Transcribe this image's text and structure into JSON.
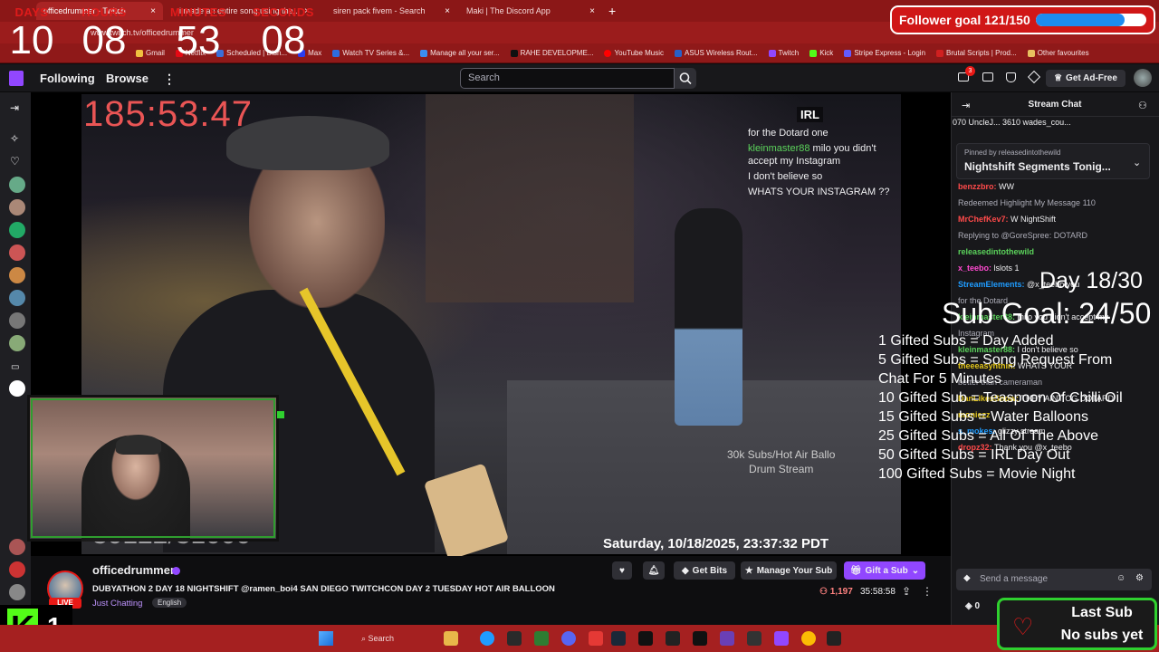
{
  "browser": {
    "tabs": [
      {
        "label": "officedrummer - Twitch",
        "active": true
      },
      {
        "label": "i made an entire song using the...",
        "active": false
      },
      {
        "label": "siren pack fivem - Search",
        "active": false
      },
      {
        "label": "Maki | The Discord App",
        "active": false
      }
    ],
    "url": "www.twitch.tv/officedrummer",
    "bookmarks": [
      "Gmail",
      "Netflix",
      "Scheduled | Disn...",
      "Max",
      "Watch TV Series &...",
      "Manage all your ser...",
      "RAHE DEVELOPME...",
      "YouTube Music",
      "ASUS Wireless Rout...",
      "Twitch",
      "Kick",
      "Stripe Express - Login",
      "Brutal Scripts | Prod...",
      "Other favourites"
    ]
  },
  "countdown": {
    "days_label": "DAYS",
    "days": "10",
    "hours_label": "HOURS",
    "hours": "08",
    "minutes_label": "MINUTES",
    "minutes": "53",
    "seconds_label": "SECONDS",
    "seconds": "08"
  },
  "follower_goal": {
    "label": "Follower goal 121/150",
    "current": 121,
    "target": 150,
    "color": "#1e8cf0"
  },
  "twitch_nav": {
    "following": "Following",
    "browse": "Browse",
    "search_placeholder": "Search",
    "notif_count": "3",
    "ad_free": "Get Ad-Free"
  },
  "video": {
    "timer": "185:53:47",
    "irl_logo": "IRL",
    "chat_overlay": [
      {
        "text": "for the Dotard one"
      },
      {
        "user": "kleinmaster88",
        "text": "milo you didn't accept my Instagram"
      },
      {
        "text": "I don't believe so"
      },
      {
        "text": "WHATS YOUR INSTAGRAM ??"
      }
    ],
    "datestamp": "Saturday, 10/18/2025, 23:37:32 PDT",
    "note_line1": "30k Subs/Hot Air Ballo",
    "note_line2": "Drum Stream",
    "sub_counter": "30122/31000"
  },
  "stream_info": {
    "channel": "officedrummer",
    "title": "DUBYATHON 2 DAY 18 NIGHTSHIFT @ramen_boi4 SAN DIEGO TWITCHCON DAY 2 TUESDAY HOT AIR BALLOON",
    "category": "Just Chatting",
    "language": "English",
    "live": "LIVE",
    "get_bits": "Get Bits",
    "manage_sub": "Manage Your Sub",
    "gift_sub": "Gift a Sub",
    "viewers": "1,197",
    "uptime": "35:58:58"
  },
  "chat": {
    "header": "Stream Chat",
    "leaderboard": "070  UncleJ...  3610  wades_cou...",
    "pinned_label": "Pinned by releasedintothewild",
    "pinned_text": "Nightshift Segments Tonig...",
    "messages": [
      {
        "user": "benzzbro",
        "text": "WW",
        "color": "#ff4a4a"
      },
      {
        "user": "",
        "text": "Redeemed Highlight My Message  110",
        "color": "#adadb8"
      },
      {
        "user": "MrChefKev7",
        "text": "W NightShift",
        "color": "#ff4a4a"
      },
      {
        "user": "",
        "text": "Replying to @GoreSpree: DOTARD",
        "color": "#adadb8"
      },
      {
        "user": "releasedintothewild",
        "text": "",
        "color": "#5bd35b"
      },
      {
        "user": "x_teebo",
        "text": "lslots 1",
        "color": "#ff4ad0"
      },
      {
        "user": "StreamElements",
        "text": "@x_teebo you",
        "color": "#1f9cff"
      },
      {
        "user": "",
        "text": "for the Dotard",
        "color": "#adadb8"
      },
      {
        "user": "kleinmaster88",
        "text": "milo you didn't accept my",
        "color": "#5bd35b"
      },
      {
        "user": "",
        "text": "Instagram",
        "color": "#adadb8"
      },
      {
        "user": "kleinmaster88",
        "text": "I don't believe so",
        "color": "#5bd35b"
      },
      {
        "user": "theeeasyhthin",
        "text": "WHATS YOUR",
        "color": "#e0c31b"
      },
      {
        "user": "",
        "text": "better than cameraman",
        "color": "#adadb8"
      },
      {
        "user": "DanLikesSnow",
        "text": "THEY AINT OG DOTARD",
        "color": "#e0c31b"
      },
      {
        "user": "moniezz",
        "text": "",
        "color": "#e0c31b"
      },
      {
        "user": "s_mokes",
        "text": "glizzy stream",
        "color": "#1f9cff"
      },
      {
        "user": "dropz32",
        "text": "Thank you  @x_teebo",
        "color": "#ff4a4a"
      }
    ],
    "input_placeholder": "Send a message",
    "points": "0"
  },
  "subathon": {
    "day": "Day 18/30",
    "sub_goal": "Sub Goal: 24/50",
    "perks": [
      "1 Gifted Subs =  Day Added",
      "5 Gifted Subs =  Song Request From",
      "Chat For 5 Minutes",
      "10 Gifted Sub = Teaspoon Of Chilli Oil",
      "15 Gifted Subs = Water Balloons",
      "25 Gifted Subs = All Of The Above",
      "50 Gifted Subs = IRL Day Out",
      "100 Gifted Subs = Movie Night"
    ]
  },
  "kick": {
    "count": "1",
    "logo": "K"
  },
  "last_sub": {
    "title": "Last Sub",
    "value": "No subs yet"
  },
  "taskbar": {
    "search": "Search"
  }
}
